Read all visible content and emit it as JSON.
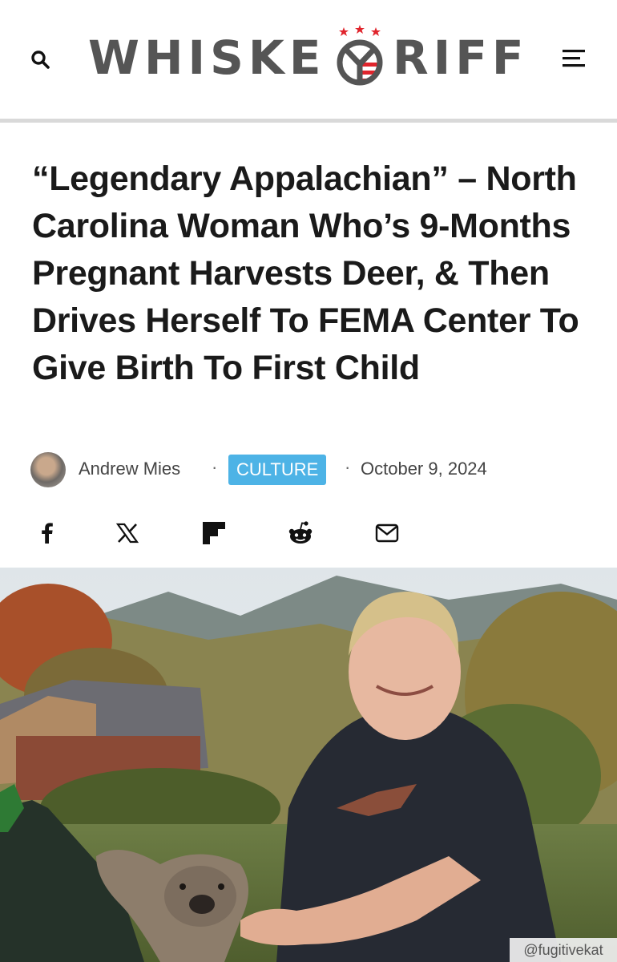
{
  "header": {
    "logo_text_left": "WHISKE",
    "logo_text_right": "RIFF",
    "brand_color": "#555555",
    "logo_star_color": "#e0242c",
    "search_icon": "search-icon",
    "menu_icon": "hamburger-menu-icon"
  },
  "article": {
    "title": "“Legendary Appalachian” – North Carolina Woman Who’s 9-Months Pregnant Harvests Deer, & Then Drives Herself To FEMA Center To Give Birth To First Child",
    "author": "Andrew Mies",
    "separator": "·",
    "category": "CULTURE",
    "category_color": "#4db3e6",
    "date": "October 9, 2024"
  },
  "share": [
    {
      "icon": "facebook-icon"
    },
    {
      "icon": "x-icon"
    },
    {
      "icon": "flipboard-icon"
    },
    {
      "icon": "reddit-icon"
    },
    {
      "icon": "email-icon"
    }
  ],
  "photo": {
    "credit": "@fugitivekat"
  }
}
